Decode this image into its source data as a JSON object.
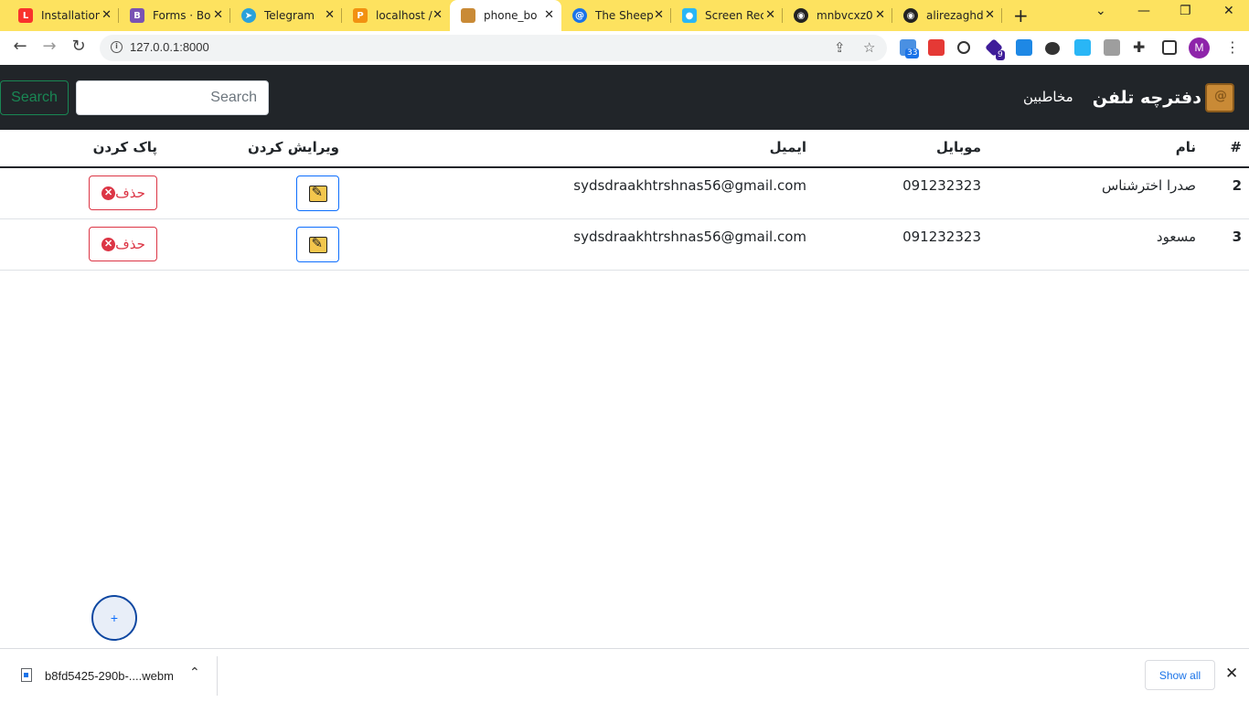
{
  "browser": {
    "tabs": [
      {
        "label": "Installation",
        "icon": "laravel-icon",
        "color": "#f9322c"
      },
      {
        "label": "Forms · Bo",
        "icon": "bootstrap-icon",
        "color": "#7952b3"
      },
      {
        "label": "Telegram",
        "icon": "telegram-icon",
        "color": "#2aa1da"
      },
      {
        "label": "localhost /",
        "icon": "phpmyadmin-icon",
        "color": "#f29111"
      },
      {
        "label": "phone_bo",
        "icon": "phonebook-icon",
        "color": "#c98a36",
        "active": true
      },
      {
        "label": "The Sheep",
        "icon": "chrome-icon",
        "color": "#1a73e8"
      },
      {
        "label": "Screen Rec",
        "icon": "screen-recorder-icon",
        "color": "#29b6f6"
      },
      {
        "label": "mnbvcxz0",
        "icon": "github-icon",
        "color": "#222222"
      },
      {
        "label": "alirezaghd",
        "icon": "github-icon",
        "color": "#222222"
      }
    ],
    "url": "127.0.0.1:8000",
    "profile_initial": "M",
    "extension_badges": [
      "33",
      "9"
    ]
  },
  "navbar": {
    "brand": "دفترچه تلفن",
    "link": "مخاطبین",
    "search_placeholder": "Search",
    "search_button": "Search"
  },
  "table": {
    "headers": {
      "number": "#",
      "name": "نام",
      "mobile": "موبایل",
      "email": "ایمیل",
      "edit": "ویرایش کردن",
      "delete": "پاک کردن"
    },
    "rows": [
      {
        "id": "2",
        "name": "صدرا اخترشناس",
        "mobile": "091232323",
        "email": "sydsdraakhtrshnas56@gmail.com",
        "delete_label": "حذف"
      },
      {
        "id": "3",
        "name": "مسعود",
        "mobile": "091232323",
        "email": "sydsdraakhtrshnas56@gmail.com",
        "delete_label": "حذف"
      }
    ]
  },
  "fab_label": "+",
  "downloads": {
    "file_name": "b8fd5425-290b-....webm",
    "show_all": "Show all"
  },
  "colors": {
    "tab_strip": "#fde25f",
    "navbar_bg": "#212529",
    "success": "#198754",
    "danger": "#dc3545",
    "primary": "#0d6efd"
  }
}
